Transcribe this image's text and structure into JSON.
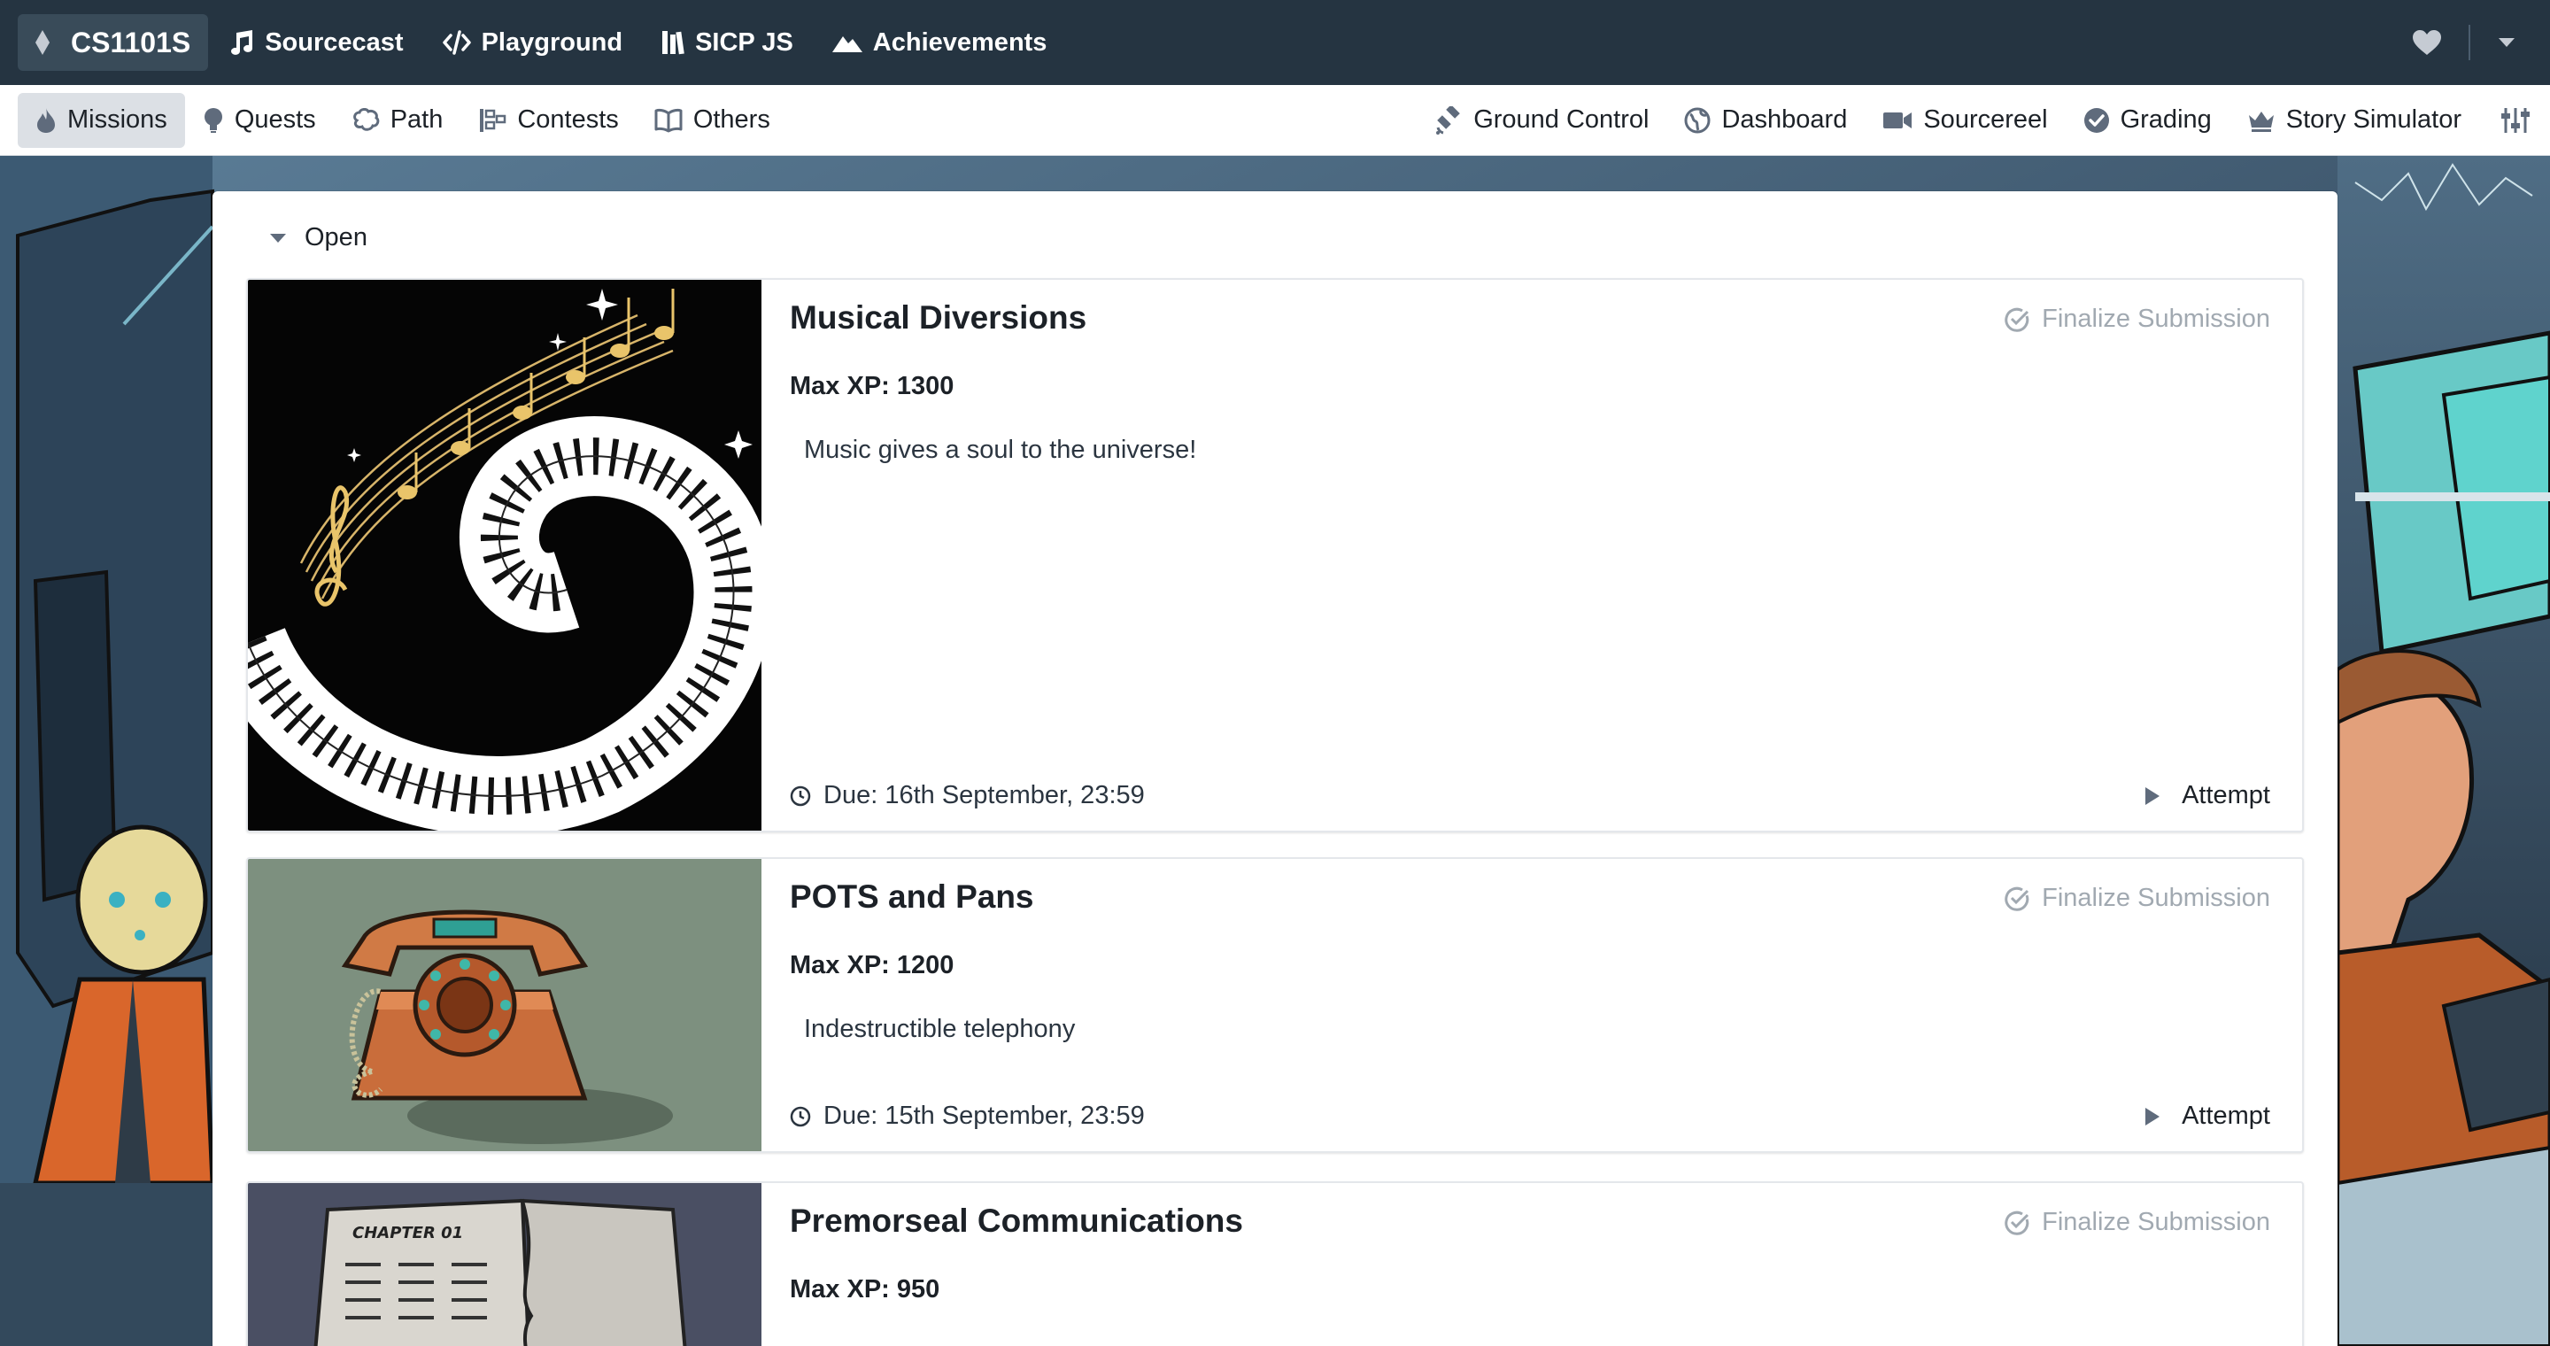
{
  "topbar": {
    "brand": "CS1101S",
    "nav": [
      {
        "label": "Sourcecast",
        "icon": "music-icon"
      },
      {
        "label": "Playground",
        "icon": "code-icon"
      },
      {
        "label": "SICP JS",
        "icon": "book-stack-icon"
      },
      {
        "label": "Achievements",
        "icon": "mountain-icon"
      }
    ],
    "right_icons": [
      "heart-icon",
      "caret-down-icon"
    ]
  },
  "subbar": {
    "left": [
      {
        "label": "Missions",
        "icon": "flame-icon",
        "active": true
      },
      {
        "label": "Quests",
        "icon": "lightbulb-icon"
      },
      {
        "label": "Path",
        "icon": "brain-icon"
      },
      {
        "label": "Contests",
        "icon": "contests-icon"
      },
      {
        "label": "Others",
        "icon": "open-book-icon"
      }
    ],
    "right": [
      {
        "label": "Ground Control",
        "icon": "satellite-icon"
      },
      {
        "label": "Dashboard",
        "icon": "globe-icon"
      },
      {
        "label": "Sourcereel",
        "icon": "video-icon"
      },
      {
        "label": "Grading",
        "icon": "check-circle-icon"
      },
      {
        "label": "Story Simulator",
        "icon": "crown-icon"
      }
    ],
    "settings_icon": "sliders-icon"
  },
  "section": {
    "label": "Open"
  },
  "missions": [
    {
      "title": "Musical Diversions",
      "max_xp": "Max XP: 1300",
      "description": "Music gives a soul to the universe!",
      "due": "Due: 16th September, 23:59",
      "finalize": "Finalize Submission",
      "attempt": "Attempt"
    },
    {
      "title": "POTS and Pans",
      "max_xp": "Max XP: 1200",
      "description": "Indestructible telephony",
      "due": "Due: 15th September, 23:59",
      "finalize": "Finalize Submission",
      "attempt": "Attempt"
    },
    {
      "title": "Premorseal Communications",
      "max_xp": "Max XP: 950",
      "description": "",
      "finalize": "Finalize Submission",
      "thumbnail_text": "CHAPTER 01"
    }
  ],
  "colors": {
    "topbar_bg": "#253441",
    "panel_bg": "#ffffff",
    "text": "#1c2127",
    "muted": "#a1a9b1"
  }
}
